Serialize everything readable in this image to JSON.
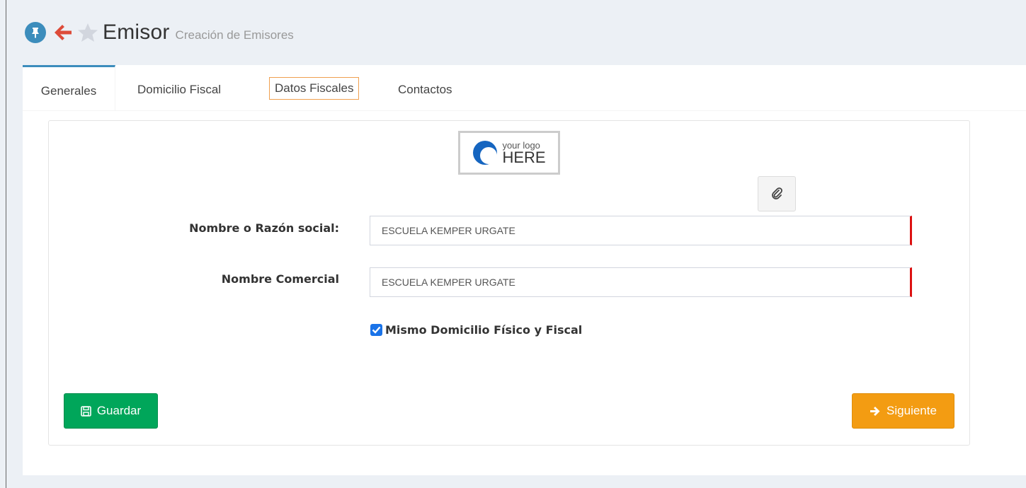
{
  "header": {
    "title": "Emisor",
    "subtitle": "Creación de Emisores",
    "icons": [
      "pin-icon",
      "back-arrow-icon",
      "star-icon"
    ]
  },
  "tabs": [
    {
      "label": "Generales",
      "active": true
    },
    {
      "label": "Domicilio Fiscal",
      "active": false
    },
    {
      "label": "Datos Fiscales",
      "active": false
    },
    {
      "label": "Contactos",
      "active": false
    }
  ],
  "logo": {
    "line1": "your logo",
    "line2": "HERE"
  },
  "form": {
    "razon_social_label": "Nombre o Razón social:",
    "razon_social_value": "ESCUELA KEMPER URGATE",
    "nombre_comercial_label": "Nombre Comercial",
    "nombre_comercial_value": "ESCUELA KEMPER URGATE",
    "mismo_domicilio_label": "Mismo Domicilio Físico y Fiscal",
    "mismo_domicilio_checked": true
  },
  "buttons": {
    "guardar": "Guardar",
    "siguiente": "Siguiente"
  },
  "colors": {
    "primary": "#3c8dbc",
    "success": "#00a65a",
    "warning": "#f39c12",
    "required": "#dd1111",
    "highlight": "#f0a050"
  }
}
